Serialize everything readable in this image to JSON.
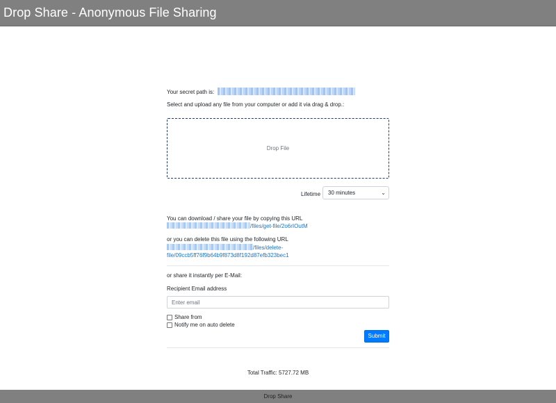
{
  "header": {
    "title": "Drop Share - Anonymous File Sharing"
  },
  "upload": {
    "secret_path_label": "Your secret path is:",
    "instruction": "Select and upload any file from your computer or add it via drag & drop.:",
    "dropzone_label": "Drop File",
    "lifetime_label": "Lifetime",
    "lifetime_value": "30 minutes"
  },
  "links": {
    "download_label": "You can download / share your file by copying this URL",
    "download_url_tail": "/files/get-file/2o6rIOutM",
    "delete_label": "or you can delete this file using the following URL",
    "delete_url_tail_1": "/files/delete-",
    "delete_url_tail_2": "file/09ccb5ff76f9b64b9f873d8f192d87efb323bec1"
  },
  "email": {
    "share_label": "or share it instantly per E-Mail:",
    "recipient_label": "Recipient Email address",
    "placeholder": "Enter email",
    "share_from_label": "Share from",
    "notify_label": "Notify me on auto delete",
    "submit_label": "Submit"
  },
  "stats": {
    "traffic": "Total Traffic: 5727.72 MB"
  },
  "footer": {
    "text": "Drop Share"
  },
  "colors": {
    "bar": "#808080",
    "primary": "#007bff",
    "link": "#1a73c7",
    "dropzone_border": "#1f3a6e"
  },
  "icons": {
    "select_chevron": "chevron-down-icon"
  }
}
